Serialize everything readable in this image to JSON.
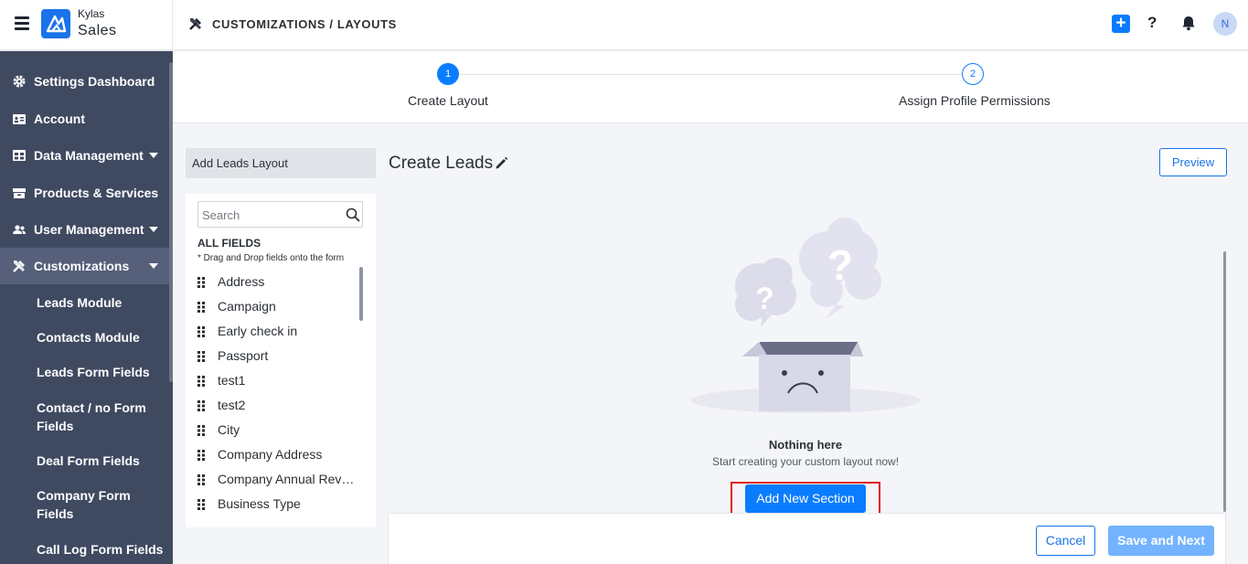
{
  "app": {
    "brand_top": "Kylas",
    "brand_bottom": "Sales",
    "logo_icon": "kylas-logo"
  },
  "header": {
    "breadcrumb": "CUSTOMIZATIONS / LAYOUTS",
    "breadcrumb_icon": "tools-icon",
    "avatar_initial": "N",
    "plus_label": "+",
    "help_label": "?"
  },
  "sidebar": {
    "items": [
      {
        "label": "Settings Dashboard",
        "icon": "gear-icon"
      },
      {
        "label": "Account",
        "icon": "id-card-icon"
      },
      {
        "label": "Data Management",
        "icon": "table-icon",
        "expandable": true
      },
      {
        "label": "Products & Services",
        "icon": "box-icon"
      },
      {
        "label": "User Management",
        "icon": "users-icon",
        "expandable": true
      },
      {
        "label": "Customizations",
        "icon": "tools-icon",
        "expandable": true,
        "active": true
      }
    ],
    "subitems": [
      "Leads Module",
      "Contacts Module",
      "Leads Form Fields",
      "Contact / no Form Fields",
      "Deal Form Fields",
      "Company Form Fields",
      "Call Log Form Fields"
    ]
  },
  "stepper": {
    "steps": [
      {
        "number": "1",
        "label": "Create Layout",
        "state": "active"
      },
      {
        "number": "2",
        "label": "Assign Profile Permissions",
        "state": "pending"
      }
    ]
  },
  "fields_panel": {
    "layout_name": "Add Leads Layout",
    "search_placeholder": "Search",
    "section_title": "ALL FIELDS",
    "hint": "* Drag and Drop fields onto the form",
    "fields": [
      "Address",
      "Campaign",
      "Early check in",
      "Passport",
      "test1",
      "test2",
      "City",
      "Company Address",
      "Company Annual Reve...",
      "Business Type"
    ]
  },
  "main": {
    "form_title": "Create Leads",
    "preview_label": "Preview",
    "empty_title": "Nothing here",
    "empty_subtitle": "Start creating your custom layout now!",
    "add_section_label": "Add New Section"
  },
  "footer": {
    "cancel_label": "Cancel",
    "save_label": "Save and Next"
  },
  "colors": {
    "primary": "#0a7cff",
    "sidebar_bg": "#3f4a61",
    "highlight": "#e0151d",
    "save_disabled": "#73b3ff"
  }
}
